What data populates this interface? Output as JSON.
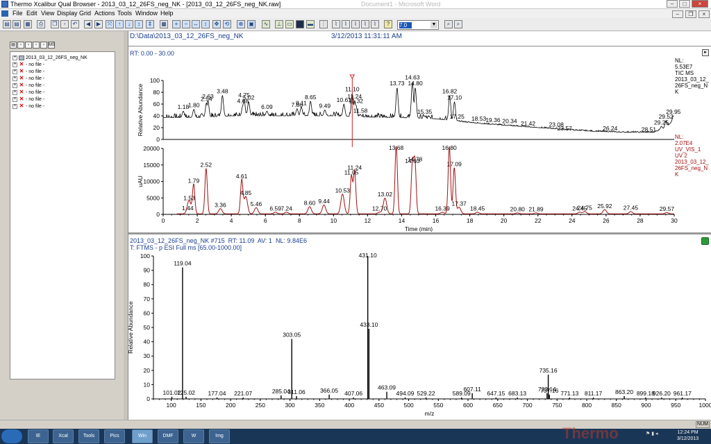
{
  "window": {
    "title": "Thermo Xcalibur Qual Browser - 2013_03_12_26FS_neg_NK - [2013_03_12_26FS_neg_NK.raw]",
    "ghost_text": "Document1 - Microsoft Word"
  },
  "menu": [
    "File",
    "Edit",
    "View",
    "Display",
    "Grid",
    "Actions",
    "Tools",
    "Window",
    "Help"
  ],
  "toolbar": {
    "rt_value": "7.0"
  },
  "tree": {
    "root": "2013_03_12_26FS_neg_NK",
    "empty_label": "- no file -",
    "empty_count": 7
  },
  "header": {
    "path": "D:\\Data\\2013_03_12_26FS_neg_NK",
    "datetime": "3/12/2013 11:31:11 AM"
  },
  "top_pane": {
    "rt_range": "RT: 0.00 - 30.00",
    "tic_info": [
      "NL:",
      "5.53E7",
      "TIC MS",
      "2013_03_12_",
      "26FS_neg_N",
      "K"
    ],
    "uv_info": [
      "NL:",
      "2.07E4",
      "UV_VIS_1",
      "UV 2",
      "2013_03_12_",
      "26FS_neg_N",
      "K"
    ],
    "x_label": "Time (min)"
  },
  "bottom_pane": {
    "header_line1": [
      "2013_03_12_26FS_neg_NK #715",
      "RT:",
      "11.09",
      "AV:",
      "1",
      "NL:",
      "9.84E6"
    ],
    "header_line2": "T: FTMS - p ESI Full ms [65.00-1000.00]"
  },
  "chart_data": [
    {
      "type": "line",
      "title": "",
      "ylabel": "Relative Abundance",
      "xlabel": "",
      "xlim": [
        0,
        30
      ],
      "ylim": [
        0,
        100
      ],
      "x_ticks": [],
      "y_ticks": [
        0,
        20,
        40,
        60,
        80,
        100
      ],
      "grid": false,
      "cursor_rt": 11.1,
      "peaks": [
        {
          "x": 1.18,
          "y": 48,
          "label": "1.18"
        },
        {
          "x": 1.8,
          "y": 51,
          "label": "1.80"
        },
        {
          "x": 2.54,
          "y": 62,
          "label": "2.54"
        },
        {
          "x": 2.63,
          "y": 66,
          "label": "2.63"
        },
        {
          "x": 3.48,
          "y": 75,
          "label": "3.48"
        },
        {
          "x": 4.68,
          "y": 58,
          "label": "4.68"
        },
        {
          "x": 4.75,
          "y": 68,
          "label": "4.75"
        },
        {
          "x": 5.02,
          "y": 64,
          "label": "5.02"
        },
        {
          "x": 6.09,
          "y": 48,
          "label": "6.09"
        },
        {
          "x": 7.86,
          "y": 52,
          "label": "7.86"
        },
        {
          "x": 8.11,
          "y": 55,
          "label": "8.11"
        },
        {
          "x": 8.65,
          "y": 65,
          "label": "8.65"
        },
        {
          "x": 9.49,
          "y": 50,
          "label": "9.49"
        },
        {
          "x": 10.61,
          "y": 60,
          "label": "10.61"
        },
        {
          "x": 11.1,
          "y": 78,
          "label": "11.10"
        },
        {
          "x": 11.24,
          "y": 66,
          "label": "11.24"
        },
        {
          "x": 11.32,
          "y": 58,
          "label": "11.32"
        },
        {
          "x": 11.58,
          "y": 42,
          "label": "11.58"
        },
        {
          "x": 13.73,
          "y": 88,
          "label": "13.73"
        },
        {
          "x": 14.63,
          "y": 98,
          "label": "14.63"
        },
        {
          "x": 14.8,
          "y": 88,
          "label": "14.80"
        },
        {
          "x": 15.35,
          "y": 40,
          "label": "15.35"
        },
        {
          "x": 16.82,
          "y": 75,
          "label": "16.82"
        },
        {
          "x": 17.1,
          "y": 64,
          "label": "17.10"
        },
        {
          "x": 17.25,
          "y": 32,
          "label": "17.25"
        },
        {
          "x": 18.53,
          "y": 28,
          "label": "18.53"
        },
        {
          "x": 19.36,
          "y": 26,
          "label": "19.36"
        },
        {
          "x": 20.34,
          "y": 24,
          "label": "20.34"
        },
        {
          "x": 21.42,
          "y": 20,
          "label": "21.42"
        },
        {
          "x": 23.08,
          "y": 18,
          "label": "23.08"
        },
        {
          "x": 23.57,
          "y": 12,
          "label": "23.57"
        },
        {
          "x": 26.24,
          "y": 12,
          "label": "26.24"
        },
        {
          "x": 28.51,
          "y": 10,
          "label": "28.51"
        },
        {
          "x": 29.25,
          "y": 22,
          "label": "29.25"
        },
        {
          "x": 29.52,
          "y": 32,
          "label": "29.52"
        },
        {
          "x": 29.95,
          "y": 40,
          "label": "29.95"
        }
      ],
      "baseline": [
        [
          0,
          37
        ],
        [
          2,
          37
        ],
        [
          4,
          40
        ],
        [
          6,
          40
        ],
        [
          8,
          40
        ],
        [
          10,
          40
        ],
        [
          12,
          38
        ],
        [
          14,
          37
        ],
        [
          16,
          35
        ],
        [
          17.5,
          30
        ],
        [
          19,
          26
        ],
        [
          21,
          22
        ],
        [
          23,
          18
        ],
        [
          25,
          14
        ],
        [
          27,
          12
        ],
        [
          28.8,
          12
        ],
        [
          29.5,
          20
        ],
        [
          30,
          32
        ]
      ],
      "color": "#000000"
    },
    {
      "type": "line",
      "title": "",
      "ylabel": "uAU",
      "xlabel": "Time (min)",
      "xlim": [
        0,
        30
      ],
      "ylim": [
        0,
        20000
      ],
      "x_ticks": [
        0,
        2,
        4,
        6,
        8,
        10,
        12,
        14,
        16,
        18,
        20,
        22,
        24,
        26,
        28,
        30
      ],
      "y_ticks": [
        0,
        5000,
        10000,
        15000,
        20000
      ],
      "grid": false,
      "peaks": [
        {
          "x": 1.44,
          "y": 600,
          "label": "1.44"
        },
        {
          "x": 1.53,
          "y": 3700,
          "label": "1.53"
        },
        {
          "x": 1.79,
          "y": 9000,
          "label": "1.79"
        },
        {
          "x": 2.52,
          "y": 13800,
          "label": "2.52"
        },
        {
          "x": 3.36,
          "y": 1600,
          "label": "3.36"
        },
        {
          "x": 4.61,
          "y": 10300,
          "label": "4.61"
        },
        {
          "x": 4.85,
          "y": 5300,
          "label": "4.85"
        },
        {
          "x": 5.46,
          "y": 1900,
          "label": "5.46"
        },
        {
          "x": 6.59,
          "y": 500,
          "label": "6.59"
        },
        {
          "x": 7.24,
          "y": 500,
          "label": "7.24"
        },
        {
          "x": 8.6,
          "y": 2200,
          "label": "8.60"
        },
        {
          "x": 9.44,
          "y": 2700,
          "label": "9.44"
        },
        {
          "x": 10.53,
          "y": 6000,
          "label": "10.53"
        },
        {
          "x": 11.05,
          "y": 11500,
          "label": "11.05"
        },
        {
          "x": 11.24,
          "y": 13000,
          "label": "11.24"
        },
        {
          "x": 12.7,
          "y": 500,
          "label": "12.70"
        },
        {
          "x": 13.02,
          "y": 4800,
          "label": "13.02"
        },
        {
          "x": 13.68,
          "y": 20700,
          "label": "13.68"
        },
        {
          "x": 14.63,
          "y": 15000,
          "label": "14.63"
        },
        {
          "x": 14.78,
          "y": 15500,
          "label": "14.78"
        },
        {
          "x": 16.39,
          "y": 500,
          "label": "16.39"
        },
        {
          "x": 16.8,
          "y": 20500,
          "label": "16.80"
        },
        {
          "x": 17.09,
          "y": 14000,
          "label": "17.09"
        },
        {
          "x": 17.37,
          "y": 2000,
          "label": "17.37"
        },
        {
          "x": 18.45,
          "y": 500,
          "label": "18.45"
        },
        {
          "x": 20.8,
          "y": 300,
          "label": "20.80"
        },
        {
          "x": 21.89,
          "y": 300,
          "label": "21.89"
        },
        {
          "x": 24.45,
          "y": 500,
          "label": "24.45"
        },
        {
          "x": 24.75,
          "y": 700,
          "label": "24.75"
        },
        {
          "x": 25.92,
          "y": 1300,
          "label": "25.92"
        },
        {
          "x": 27.45,
          "y": 700,
          "label": "27.45"
        },
        {
          "x": 29.57,
          "y": 400,
          "label": "29.57"
        }
      ],
      "color": "#a01010"
    },
    {
      "type": "bar",
      "title": "",
      "ylabel": "Relative Abundance",
      "xlabel": "m/z",
      "xlim": [
        70,
        1000
      ],
      "ylim": [
        0,
        100
      ],
      "x_ticks": [
        100,
        150,
        200,
        250,
        300,
        350,
        400,
        450,
        500,
        550,
        600,
        650,
        700,
        750,
        800,
        850,
        900,
        950,
        1000
      ],
      "y_ticks": [
        0,
        10,
        20,
        30,
        40,
        50,
        60,
        70,
        80,
        90,
        100
      ],
      "grid": false,
      "peaks": [
        {
          "x": 101.02,
          "y": 1.5,
          "label": "101.02"
        },
        {
          "x": 119.04,
          "y": 92,
          "label": "119.04"
        },
        {
          "x": 125.02,
          "y": 1.5,
          "label": "125.02"
        },
        {
          "x": 177.04,
          "y": 1,
          "label": "177.04"
        },
        {
          "x": 221.07,
          "y": 1,
          "label": "221.07"
        },
        {
          "x": 285.04,
          "y": 2.5,
          "label": "285.04"
        },
        {
          "x": 303.05,
          "y": 42,
          "label": "303.05"
        },
        {
          "x": 311.06,
          "y": 2,
          "label": "311.06"
        },
        {
          "x": 366.05,
          "y": 3,
          "label": "366.05"
        },
        {
          "x": 407.06,
          "y": 1,
          "label": "407.06"
        },
        {
          "x": 431.1,
          "y": 100,
          "label": "431.10"
        },
        {
          "x": 433.1,
          "y": 49,
          "label": "433.10"
        },
        {
          "x": 463.09,
          "y": 5,
          "label": "463.09"
        },
        {
          "x": 494.09,
          "y": 1,
          "label": "494.09"
        },
        {
          "x": 529.22,
          "y": 1,
          "label": "529.22"
        },
        {
          "x": 589.09,
          "y": 1,
          "label": "589.09"
        },
        {
          "x": 607.11,
          "y": 4,
          "label": "607.11"
        },
        {
          "x": 647.15,
          "y": 1,
          "label": "647.15"
        },
        {
          "x": 683.13,
          "y": 1,
          "label": "683.13"
        },
        {
          "x": 733.14,
          "y": 4,
          "label": "733.14"
        },
        {
          "x": 735.16,
          "y": 17,
          "label": "735.16"
        },
        {
          "x": 737.16,
          "y": 3,
          "label": "737.16"
        },
        {
          "x": 771.13,
          "y": 1,
          "label": "771.13"
        },
        {
          "x": 811.17,
          "y": 1,
          "label": "811.17"
        },
        {
          "x": 863.2,
          "y": 2,
          "label": "863.20"
        },
        {
          "x": 899.18,
          "y": 1,
          "label": "899.18"
        },
        {
          "x": 926.2,
          "y": 1,
          "label": "926.20"
        },
        {
          "x": 961.17,
          "y": 1,
          "label": "961.17"
        }
      ],
      "color": "#000000"
    }
  ],
  "statusbar": {
    "num": "NUM"
  },
  "taskbar": {
    "apps": [
      "IE",
      "Xcal",
      "Tools",
      "Pics",
      "Win",
      "DMF",
      "W",
      "Img"
    ],
    "time": "12:24 PM",
    "date": "3/12/2013",
    "watermark": "Thermo"
  }
}
